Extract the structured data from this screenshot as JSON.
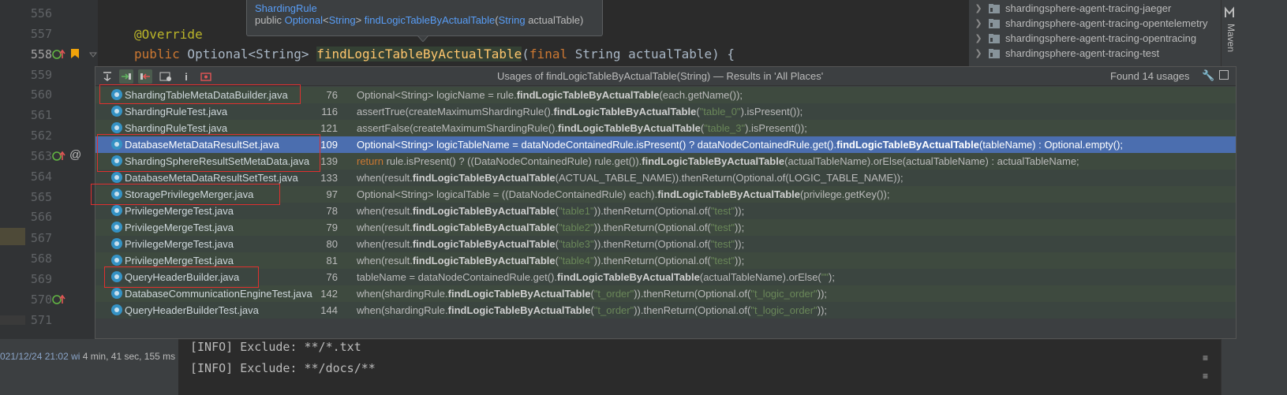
{
  "editor": {
    "line_numbers": [
      "556",
      "557",
      "558",
      "559",
      "560",
      "561",
      "562",
      "563",
      "564",
      "565",
      "566",
      "567",
      "568",
      "569",
      "570",
      "571"
    ],
    "current_line": "558",
    "code_annotation": "@Override",
    "code_signature": {
      "kw_public": "public",
      "ret_type": " Optional<String> ",
      "method": "findLogicTableByActualTable",
      "paren_open": "(",
      "kw_final": "final",
      "params": " String actualTable) {"
    }
  },
  "tooltip": {
    "class_name": "ShardingRule",
    "sig_public": "public ",
    "sig_type": "Optional",
    "sig_lt": "<",
    "sig_generic": "String",
    "sig_gt": "> ",
    "sig_method": "findLogicTableByActualTable",
    "sig_open": "(",
    "sig_param_type": "String",
    "sig_param": " actualTable)"
  },
  "project_tree": {
    "items": [
      "shardingsphere-agent-tracing-jaeger",
      "shardingsphere-agent-tracing-opentelemetry",
      "shardingsphere-agent-tracing-opentracing",
      "shardingsphere-agent-tracing-test"
    ],
    "maven_tab": "Maven"
  },
  "usages": {
    "title": "Usages of findLogicTableByActualTable(String) — Results in 'All Places'",
    "found": "Found 14 usages",
    "rows": [
      {
        "file": "ShardingTableMetaDataBuilder.java",
        "line": "76",
        "parts": [
          [
            "t",
            "Optional<String> logicName = rule."
          ],
          [
            "b",
            "findLogicTableByActualTable"
          ],
          [
            "t",
            "(each.getName());"
          ]
        ]
      },
      {
        "file": "ShardingRuleTest.java",
        "line": "116",
        "parts": [
          [
            "t",
            "assertTrue(createMaximumShardingRule()."
          ],
          [
            "b",
            "findLogicTableByActualTable"
          ],
          [
            "t",
            "("
          ],
          [
            "s",
            "\"table_0\""
          ],
          [
            "t",
            ").isPresent());"
          ]
        ]
      },
      {
        "file": "ShardingRuleTest.java",
        "line": "121",
        "parts": [
          [
            "t",
            "assertFalse(createMaximumShardingRule()."
          ],
          [
            "b",
            "findLogicTableByActualTable"
          ],
          [
            "t",
            "("
          ],
          [
            "s",
            "\"table_3\""
          ],
          [
            "t",
            ").isPresent());"
          ]
        ]
      },
      {
        "file": "DatabaseMetaDataResultSet.java",
        "line": "109",
        "parts": [
          [
            "t",
            "Optional<String> logicTableName = dataNodeContainedRule.isPresent() ? dataNodeContainedRule.get()."
          ],
          [
            "b",
            "findLogicTableByActualTable"
          ],
          [
            "t",
            "(tableName) : Optional.empty();"
          ]
        ]
      },
      {
        "file": "ShardingSphereResultSetMetaData.java",
        "line": "139",
        "parts": [
          [
            "k",
            "return"
          ],
          [
            "t",
            " rule.isPresent() ? ((DataNodeContainedRule) rule.get())."
          ],
          [
            "b",
            "findLogicTableByActualTable"
          ],
          [
            "t",
            "(actualTableName).orElse(actualTableName) : actualTableName;"
          ]
        ]
      },
      {
        "file": "DatabaseMetaDataResultSetTest.java",
        "line": "133",
        "parts": [
          [
            "t",
            "when(result."
          ],
          [
            "b",
            "findLogicTableByActualTable"
          ],
          [
            "t",
            "(ACTUAL_TABLE_NAME)).thenReturn(Optional.of(LOGIC_TABLE_NAME));"
          ]
        ]
      },
      {
        "file": "StoragePrivilegeMerger.java",
        "line": "97",
        "parts": [
          [
            "t",
            "Optional<String> logicalTable = ((DataNodeContainedRule) each)."
          ],
          [
            "b",
            "findLogicTableByActualTable"
          ],
          [
            "t",
            "(privilege.getKey());"
          ]
        ]
      },
      {
        "file": "PrivilegeMergeTest.java",
        "line": "78",
        "parts": [
          [
            "t",
            "when(result."
          ],
          [
            "b",
            "findLogicTableByActualTable"
          ],
          [
            "t",
            "("
          ],
          [
            "s",
            "\"table1\""
          ],
          [
            "t",
            ")).thenReturn(Optional.of("
          ],
          [
            "s",
            "\"test\""
          ],
          [
            "t",
            "));"
          ]
        ]
      },
      {
        "file": "PrivilegeMergeTest.java",
        "line": "79",
        "parts": [
          [
            "t",
            "when(result."
          ],
          [
            "b",
            "findLogicTableByActualTable"
          ],
          [
            "t",
            "("
          ],
          [
            "s",
            "\"table2\""
          ],
          [
            "t",
            ")).thenReturn(Optional.of("
          ],
          [
            "s",
            "\"test\""
          ],
          [
            "t",
            "));"
          ]
        ]
      },
      {
        "file": "PrivilegeMergeTest.java",
        "line": "80",
        "parts": [
          [
            "t",
            "when(result."
          ],
          [
            "b",
            "findLogicTableByActualTable"
          ],
          [
            "t",
            "("
          ],
          [
            "s",
            "\"table3\""
          ],
          [
            "t",
            ")).thenReturn(Optional.of("
          ],
          [
            "s",
            "\"test\""
          ],
          [
            "t",
            "));"
          ]
        ]
      },
      {
        "file": "PrivilegeMergeTest.java",
        "line": "81",
        "parts": [
          [
            "t",
            "when(result."
          ],
          [
            "b",
            "findLogicTableByActualTable"
          ],
          [
            "t",
            "("
          ],
          [
            "s",
            "\"table4\""
          ],
          [
            "t",
            ")).thenReturn(Optional.of("
          ],
          [
            "s",
            "\"test\""
          ],
          [
            "t",
            "));"
          ]
        ]
      },
      {
        "file": "QueryHeaderBuilder.java",
        "line": "76",
        "parts": [
          [
            "t",
            "tableName = dataNodeContainedRule.get()."
          ],
          [
            "b",
            "findLogicTableByActualTable"
          ],
          [
            "t",
            "(actualTableName).orElse("
          ],
          [
            "s",
            "\"\""
          ],
          [
            "t",
            ");"
          ]
        ]
      },
      {
        "file": "DatabaseCommunicationEngineTest.java",
        "line": "142",
        "parts": [
          [
            "t",
            "when(shardingRule."
          ],
          [
            "b",
            "findLogicTableByActualTable"
          ],
          [
            "t",
            "("
          ],
          [
            "s",
            "\"t_order\""
          ],
          [
            "t",
            ")).thenReturn(Optional.of("
          ],
          [
            "s",
            "\"t_logic_order\""
          ],
          [
            "t",
            "));"
          ]
        ]
      },
      {
        "file": "QueryHeaderBuilderTest.java",
        "line": "144",
        "parts": [
          [
            "t",
            "when(shardingRule."
          ],
          [
            "b",
            "findLogicTableByActualTable"
          ],
          [
            "t",
            "("
          ],
          [
            "s",
            "\"t_order\""
          ],
          [
            "t",
            ")).thenReturn(Optional.of("
          ],
          [
            "s",
            "\"t_logic_order\""
          ],
          [
            "t",
            "));"
          ]
        ]
      }
    ]
  },
  "run": {
    "timestamp": "021/12/24 21:02 wi",
    "duration": "4 min, 41 sec, 155 ms"
  },
  "console": {
    "line1": "[INFO] Exclude: **/*.txt",
    "line2": "[INFO] Exclude: **/docs/**"
  },
  "colors": {
    "selected_row": "#4b6eaf",
    "highlight_box": "#e0302f",
    "string_literal": "#6a8759",
    "keyword": "#cc7832"
  }
}
